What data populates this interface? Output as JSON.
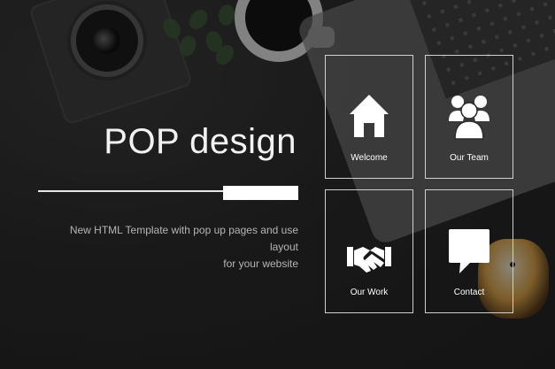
{
  "hero": {
    "title": "POP design",
    "subtitle_line1": "New HTML Template with pop up pages and use layout",
    "subtitle_line2": "for your website"
  },
  "menu": {
    "items": [
      {
        "label": "Welcome",
        "icon": "home-icon"
      },
      {
        "label": "Our Team",
        "icon": "team-icon"
      },
      {
        "label": "Our Work",
        "icon": "handshake-icon"
      },
      {
        "label": "Contact",
        "icon": "chat-bubble-icon"
      }
    ]
  },
  "colors": {
    "tile_border": "#d0d0d0",
    "text_primary": "#ffffff",
    "text_secondary": "#b5b5b5"
  }
}
